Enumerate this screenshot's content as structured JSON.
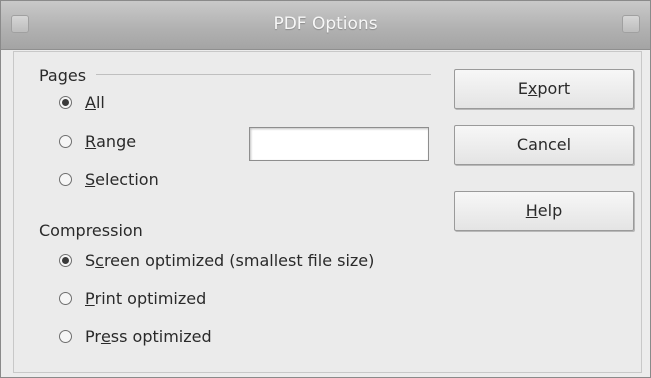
{
  "window": {
    "title": "PDF Options"
  },
  "pages": {
    "heading": "Pages",
    "options": [
      {
        "pre": "",
        "key": "A",
        "post": "ll",
        "selected": true
      },
      {
        "pre": "",
        "key": "R",
        "post": "ange",
        "selected": false
      },
      {
        "pre": "",
        "key": "S",
        "post": "election",
        "selected": false
      }
    ],
    "range_value": ""
  },
  "compression": {
    "heading": "Compression",
    "options": [
      {
        "pre": "S",
        "key": "c",
        "post": "reen optimized (smallest file size)",
        "selected": true
      },
      {
        "pre": "",
        "key": "P",
        "post": "rint optimized",
        "selected": false
      },
      {
        "pre": "Pr",
        "key": "e",
        "post": "ss optimized",
        "selected": false
      }
    ]
  },
  "buttons": {
    "export": {
      "pre": "E",
      "key": "x",
      "post": "port"
    },
    "cancel": {
      "label": "Cancel"
    },
    "help": {
      "pre": "",
      "key": "H",
      "post": "elp"
    }
  }
}
